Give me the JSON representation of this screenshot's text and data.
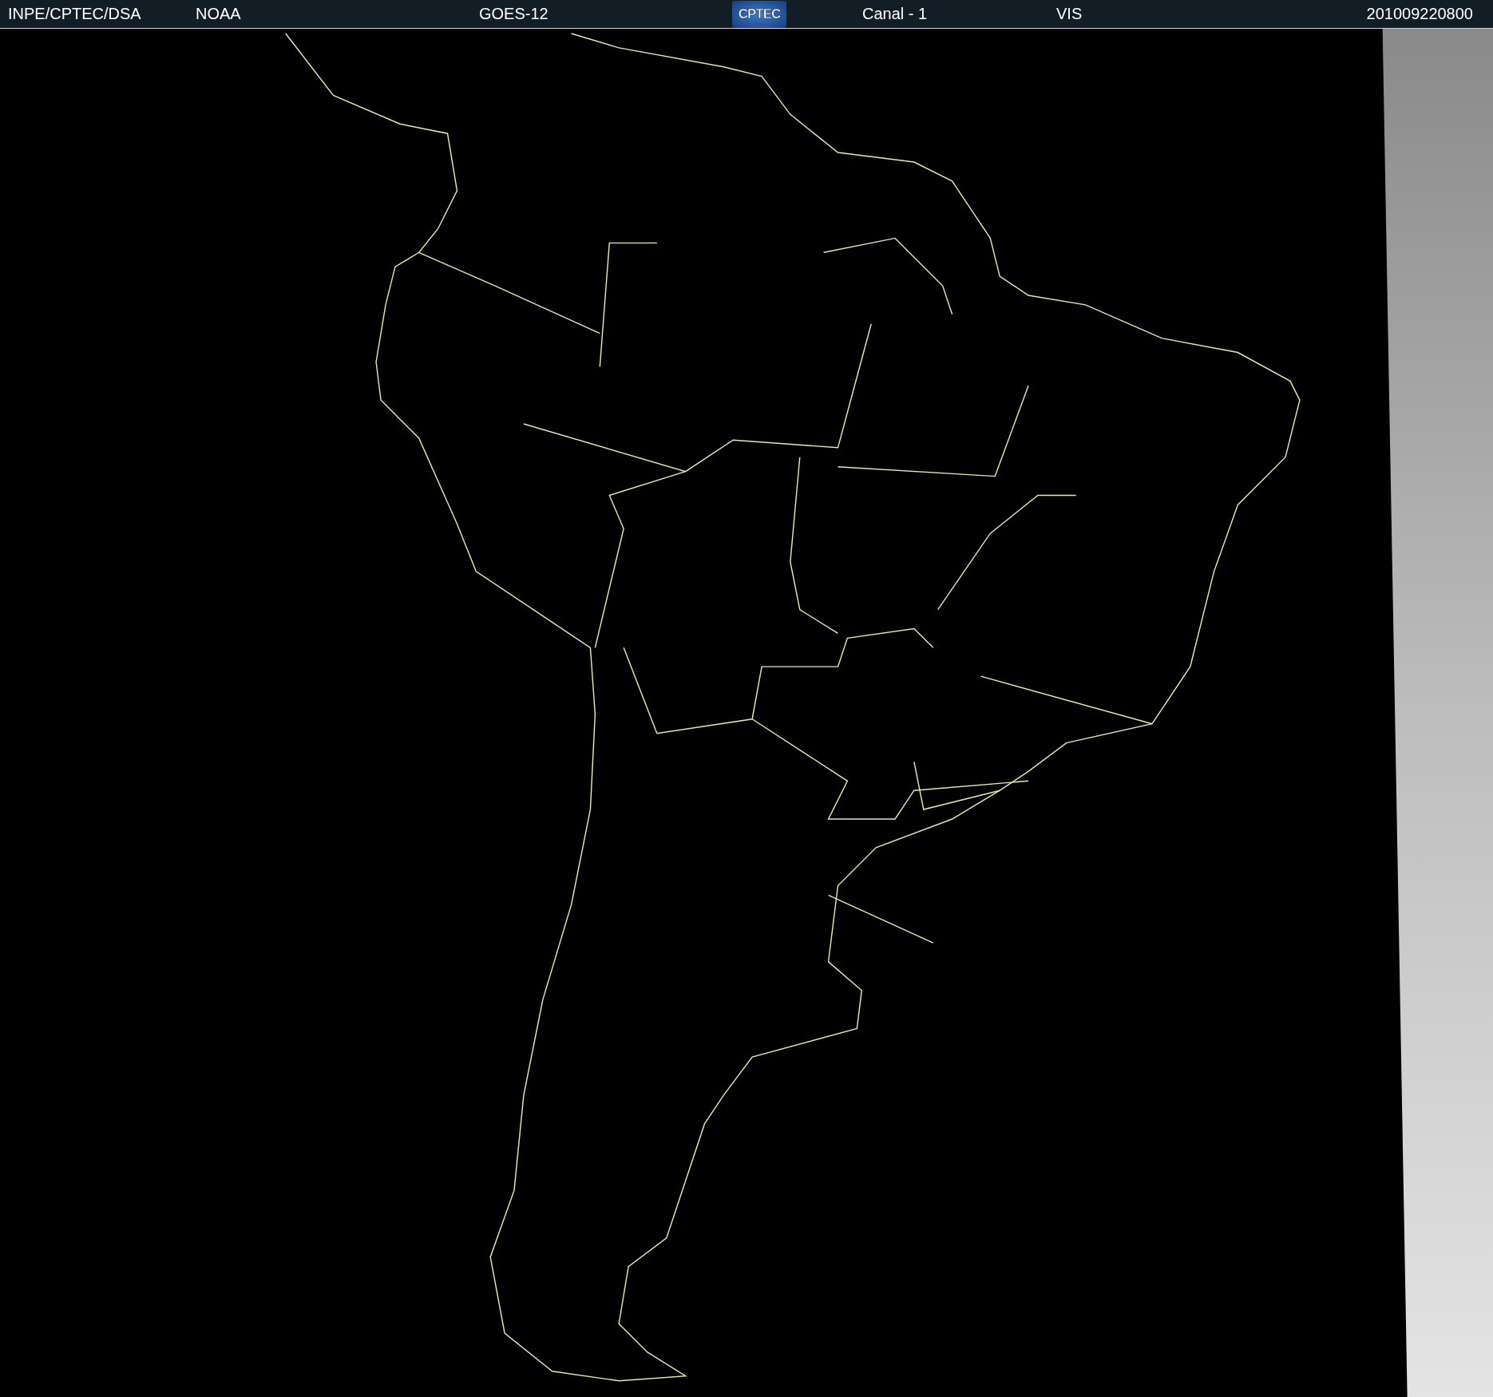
{
  "header": {
    "items": [
      {
        "kind": "text",
        "text": "INPE/CPTEC/DSA"
      },
      {
        "kind": "text",
        "text": "NOAA"
      },
      {
        "kind": "text",
        "text": "GOES-12"
      },
      {
        "kind": "logo",
        "text": "CPTEC"
      },
      {
        "kind": "text",
        "text": "Canal - 1"
      },
      {
        "kind": "text",
        "text": "VIS"
      },
      {
        "kind": "text",
        "text": "201009220800"
      }
    ]
  }
}
